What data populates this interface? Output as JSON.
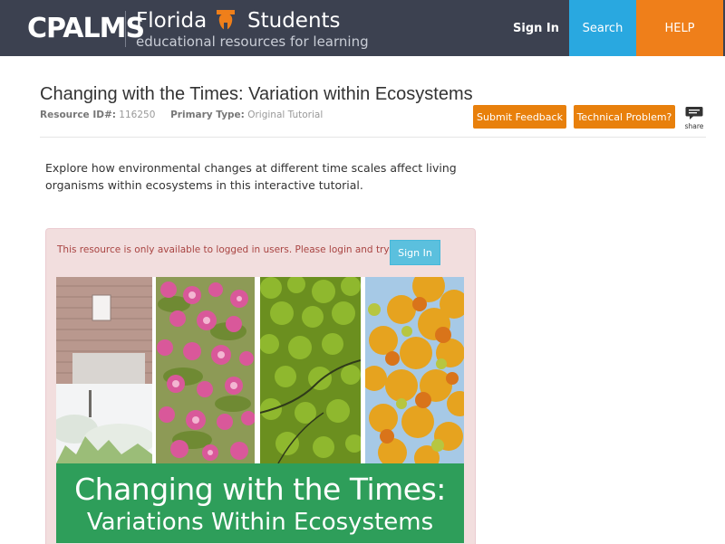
{
  "header": {
    "logo": "CPALMS",
    "brand_florida": "Florida",
    "brand_students": "Students",
    "tagline": "educational resources for learning",
    "nav": {
      "signin": "Sign In",
      "search": "Search",
      "help": "HELP"
    }
  },
  "resource": {
    "title": "Changing with the Times: Variation within Ecosystems",
    "id_label": "Resource ID#:",
    "id_value": "116250",
    "type_label": "Primary Type:",
    "type_value": "Original Tutorial",
    "submit_feedback": "Submit Feedback",
    "technical_problem": "Technical Problem?",
    "share_label": "share",
    "description": "Explore how environmental changes at different time scales affect living organisms within ecosystems in this interactive tutorial."
  },
  "alert": {
    "message": "This resource is only available to logged in users. Please login and try again.",
    "signin_button": "Sign In"
  },
  "thumbnail": {
    "title_line1": "Changing with the Times:",
    "title_line2": "Variations Within Ecosystems"
  },
  "colors": {
    "header_bg": "#3c4150",
    "search_bg": "#29a8e0",
    "help_bg": "#ef7f1a",
    "orange_button": "#e8800c",
    "alert_bg": "#f2dede",
    "alert_text": "#a94442",
    "banner_green": "#2e9e5a"
  },
  "icons": [
    "apple-teacher-icon",
    "share-speech-bubble-icon"
  ]
}
